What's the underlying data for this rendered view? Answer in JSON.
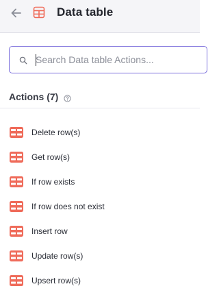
{
  "header": {
    "back_icon": "arrow-left-icon",
    "app_icon": "table-icon",
    "title": "Data table"
  },
  "search": {
    "placeholder": "Search Data table Actions...",
    "value": ""
  },
  "section": {
    "title": "Actions (7)",
    "help_icon": "question-circle-icon"
  },
  "actions": [
    {
      "label": "Delete row(s)",
      "icon": "table-icon"
    },
    {
      "label": "Get row(s)",
      "icon": "table-icon"
    },
    {
      "label": "If row exists",
      "icon": "table-icon"
    },
    {
      "label": "If row does not exist",
      "icon": "table-icon"
    },
    {
      "label": "Insert row",
      "icon": "table-icon"
    },
    {
      "label": "Update row(s)",
      "icon": "table-icon"
    },
    {
      "label": "Upsert row(s)",
      "icon": "table-icon"
    }
  ],
  "colors": {
    "accent": "#7b6fdc",
    "icon_red": "#ef6b5a",
    "header_bg": "#f5f5f8"
  }
}
